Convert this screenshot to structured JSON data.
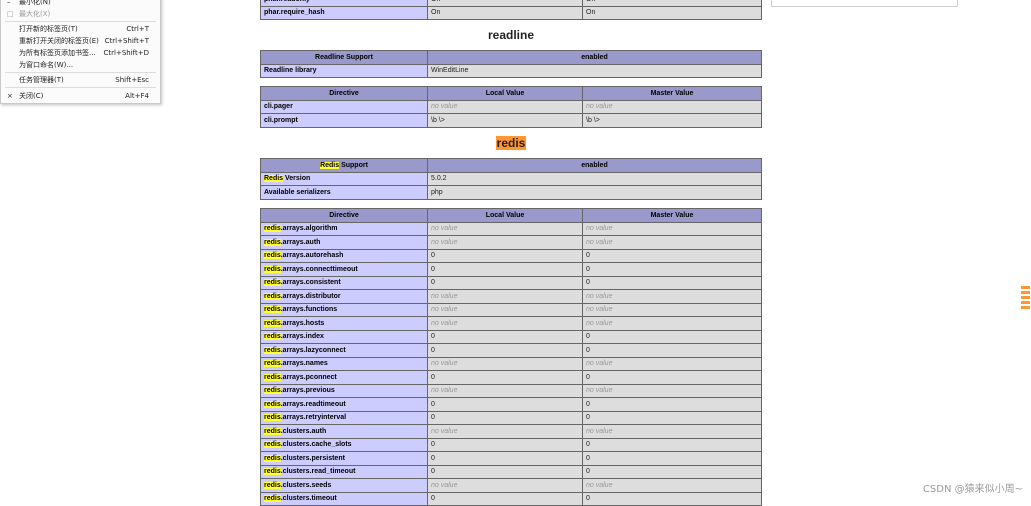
{
  "context_menu": {
    "items": [
      {
        "icon": "–",
        "label": "最小化(N)",
        "shortcut": "",
        "disabled": false
      },
      {
        "icon": "□",
        "label": "最大化(X)",
        "shortcut": "",
        "disabled": true
      },
      {
        "icon": "",
        "label": "打开新的标签页(T)",
        "shortcut": "Ctrl+T",
        "disabled": false
      },
      {
        "icon": "",
        "label": "重新打开关闭的标签页(E)",
        "shortcut": "Ctrl+Shift+T",
        "disabled": false
      },
      {
        "icon": "",
        "label": "为所有标签页添加书签...",
        "shortcut": "Ctrl+Shift+D",
        "disabled": false
      },
      {
        "icon": "",
        "label": "为窗口命名(W)...",
        "shortcut": "",
        "disabled": false
      },
      {
        "icon": "",
        "label": "任务管理器(T)",
        "shortcut": "Shift+Esc",
        "disabled": false
      },
      {
        "icon": "×",
        "label": "关闭(C)",
        "shortcut": "Alt+F4",
        "disabled": false
      }
    ]
  },
  "phar_table": {
    "rows": [
      {
        "name": "phar.readonly",
        "local": "On",
        "master": "On"
      },
      {
        "name": "phar.require_hash",
        "local": "On",
        "master": "On"
      }
    ]
  },
  "readline": {
    "title": "readline",
    "support_header": [
      "Readline Support",
      "enabled"
    ],
    "support_rows": [
      {
        "name": "Readline library",
        "value": "WinEditLine"
      }
    ],
    "directive_header": [
      "Directive",
      "Local Value",
      "Master Value"
    ],
    "directives": [
      {
        "name": "cli.pager",
        "local": "no value",
        "master": "no value"
      },
      {
        "name": "cli.prompt",
        "local": "\\b \\>",
        "master": "\\b \\>"
      }
    ]
  },
  "redis": {
    "title": "redis",
    "support_header": {
      "prefix": "Redis",
      "suffix": " Support",
      "value": "enabled"
    },
    "support_rows": [
      {
        "prefix": "Redis",
        "name": " Version",
        "value": "5.0.2"
      },
      {
        "prefix": "",
        "name": "Available serializers",
        "value": "php"
      }
    ],
    "directive_header": [
      "Directive",
      "Local Value",
      "Master Value"
    ],
    "directives": [
      {
        "prefix": "redis",
        "name": ".arrays.algorithm",
        "local": "no value",
        "master": "no value"
      },
      {
        "prefix": "redis",
        "name": ".arrays.auth",
        "local": "no value",
        "master": "no value"
      },
      {
        "prefix": "redis",
        "name": ".arrays.autorehash",
        "local": "0",
        "master": "0"
      },
      {
        "prefix": "redis",
        "name": ".arrays.connecttimeout",
        "local": "0",
        "master": "0"
      },
      {
        "prefix": "redis",
        "name": ".arrays.consistent",
        "local": "0",
        "master": "0"
      },
      {
        "prefix": "redis",
        "name": ".arrays.distributor",
        "local": "no value",
        "master": "no value"
      },
      {
        "prefix": "redis",
        "name": ".arrays.functions",
        "local": "no value",
        "master": "no value"
      },
      {
        "prefix": "redis",
        "name": ".arrays.hosts",
        "local": "no value",
        "master": "no value"
      },
      {
        "prefix": "redis",
        "name": ".arrays.index",
        "local": "0",
        "master": "0"
      },
      {
        "prefix": "redis",
        "name": ".arrays.lazyconnect",
        "local": "0",
        "master": "0"
      },
      {
        "prefix": "redis",
        "name": ".arrays.names",
        "local": "no value",
        "master": "no value"
      },
      {
        "prefix": "redis",
        "name": ".arrays.pconnect",
        "local": "0",
        "master": "0"
      },
      {
        "prefix": "redis",
        "name": ".arrays.previous",
        "local": "no value",
        "master": "no value"
      },
      {
        "prefix": "redis",
        "name": ".arrays.readtimeout",
        "local": "0",
        "master": "0"
      },
      {
        "prefix": "redis",
        "name": ".arrays.retryinterval",
        "local": "0",
        "master": "0"
      },
      {
        "prefix": "redis",
        "name": ".clusters.auth",
        "local": "no value",
        "master": "no value"
      },
      {
        "prefix": "redis",
        "name": ".clusters.cache_slots",
        "local": "0",
        "master": "0"
      },
      {
        "prefix": "redis",
        "name": ".clusters.persistent",
        "local": "0",
        "master": "0"
      },
      {
        "prefix": "redis",
        "name": ".clusters.read_timeout",
        "local": "0",
        "master": "0"
      },
      {
        "prefix": "redis",
        "name": ".clusters.seeds",
        "local": "no value",
        "master": "no value"
      },
      {
        "prefix": "redis",
        "name": ".clusters.timeout",
        "local": "0",
        "master": "0"
      }
    ]
  },
  "watermark": "CSDN @猿来似小周~",
  "colors": {
    "header": "#9999cc",
    "name_cell": "#ccccff",
    "value_cell": "#dddddd",
    "search_highlight": "#ffff33",
    "active_highlight": "#ff9632"
  }
}
